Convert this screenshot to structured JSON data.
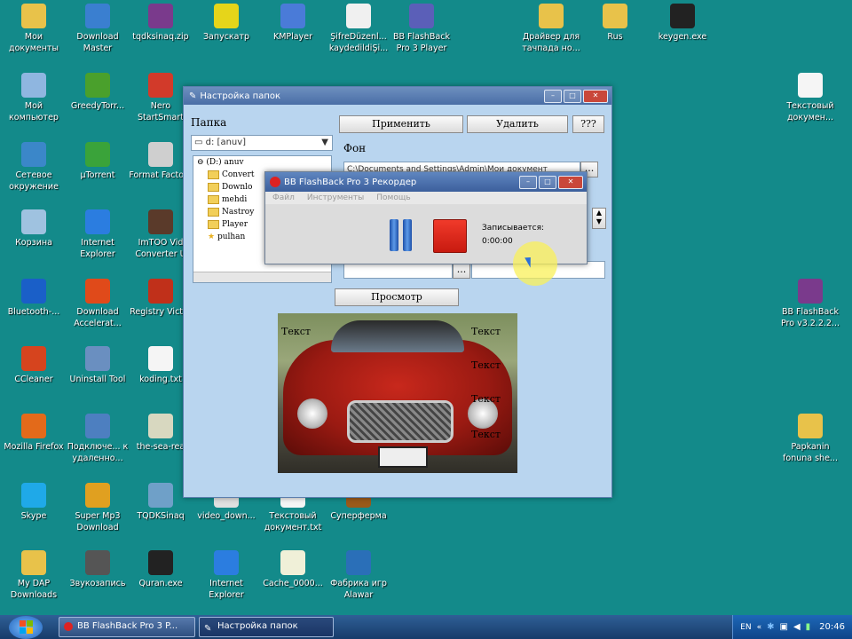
{
  "desktop_icons": [
    {
      "label": "Мои документы",
      "icon": "folder-icon",
      "color": "#e8c24a"
    },
    {
      "label": "Download Master",
      "icon": "download-master-icon",
      "color": "#3a7fd0"
    },
    {
      "label": "tqdksinaq.zip",
      "icon": "winrar-icon",
      "color": "#7a3a8c"
    },
    {
      "label": "Запускатр",
      "icon": "puzzle-icon",
      "color": "#e6d51a"
    },
    {
      "label": "KMPlayer",
      "icon": "kmplayer-icon",
      "color": "#4a7bd8"
    },
    {
      "label": "ŞifreDüzenl... kaydedildiŞi...",
      "icon": "document-icon",
      "color": "#f0f0f0"
    },
    {
      "label": "BB FlashBack Pro 3 Player",
      "icon": "bb-player-icon",
      "color": "#5b5fb8"
    },
    {
      "label": "Драйвер для тачпада но...",
      "icon": "folder-icon",
      "color": "#e8c24a"
    },
    {
      "label": "Rus",
      "icon": "folder-icon",
      "color": "#e8c24a"
    },
    {
      "label": "keygen.exe",
      "icon": "keygen-icon",
      "color": "#222222"
    },
    {
      "label": "Мой компьютер",
      "icon": "computer-icon",
      "color": "#8fb6e0"
    },
    {
      "label": "GreedyTorr...",
      "icon": "greedytorrent-icon",
      "color": "#4aa02c"
    },
    {
      "label": "Nero StartSmart",
      "icon": "nero-icon",
      "color": "#d23a2a"
    },
    {
      "label": "Текстовый докумен...",
      "icon": "text-document-icon",
      "color": "#f5f5f5"
    },
    {
      "label": "Сетевое окружение",
      "icon": "network-icon",
      "color": "#3b87c9"
    },
    {
      "label": "µTorrent",
      "icon": "utorrent-icon",
      "color": "#3aa33a"
    },
    {
      "label": "Format Factory",
      "icon": "format-factory-icon",
      "color": "#cfcfcf"
    },
    {
      "label": "Корзина",
      "icon": "recycle-bin-icon",
      "color": "#9fc2e0"
    },
    {
      "label": "Internet Explorer",
      "icon": "internet-explorer-icon",
      "color": "#2b7de0"
    },
    {
      "label": "ImTOO Vid Converter U",
      "icon": "imtoo-icon",
      "color": "#5a3a2a"
    },
    {
      "label": "Bluetooth-...",
      "icon": "bluetooth-icon",
      "color": "#1a5fc8"
    },
    {
      "label": "Download Accelerat...",
      "icon": "download-accelerator-icon",
      "color": "#e04a1a"
    },
    {
      "label": "Registry Victor",
      "icon": "registry-victor-icon",
      "color": "#c0301a"
    },
    {
      "label": "BB FlashBack Pro v3.2.2.2...",
      "icon": "winrar-icon",
      "color": "#7a3a8c"
    },
    {
      "label": "CCleaner",
      "icon": "ccleaner-icon",
      "color": "#d6441e"
    },
    {
      "label": "Uninstall Tool",
      "icon": "uninstall-tool-icon",
      "color": "#6a8fc0"
    },
    {
      "label": "koding.txt",
      "icon": "text-document-icon",
      "color": "#f5f5f5"
    },
    {
      "label": "Mozilla Firefox",
      "icon": "firefox-icon",
      "color": "#e36a1a"
    },
    {
      "label": "Подключе... к удаленно...",
      "icon": "remote-desktop-icon",
      "color": "#4d7fc0"
    },
    {
      "label": "the-sea-rea",
      "icon": "image-file-icon",
      "color": "#d8d8c0"
    },
    {
      "label": "Papkanin fonuna she...",
      "icon": "folder-icon",
      "color": "#e8c24a"
    },
    {
      "label": "Skype",
      "icon": "skype-icon",
      "color": "#1fa9e8"
    },
    {
      "label": "Super Mp3 Download",
      "icon": "super-mp3-icon",
      "color": "#e0a020"
    },
    {
      "label": "TQDKSinaq",
      "icon": "tqdk-icon",
      "color": "#6fa0c8"
    },
    {
      "label": "video_down...",
      "icon": "video-file-icon",
      "color": "#e0e0e0"
    },
    {
      "label": "Текстовый документ.txt",
      "icon": "text-document-icon",
      "color": "#f5f5f5"
    },
    {
      "label": "Суперферма",
      "icon": "superferma-icon",
      "color": "#9a5a1a"
    },
    {
      "label": "My DAP Downloads",
      "icon": "dap-folder-icon",
      "color": "#e8c24a"
    },
    {
      "label": "Звукозапись",
      "icon": "sound-recorder-icon",
      "color": "#555555"
    },
    {
      "label": "Quran.exe",
      "icon": "quran-icon",
      "color": "#222222"
    },
    {
      "label": "Internet Explorer",
      "icon": "internet-explorer-icon",
      "color": "#2b7de0"
    },
    {
      "label": "Cache_0000...",
      "icon": "cache-file-icon",
      "color": "#f0f0d8"
    },
    {
      "label": "Фабрика игр Alawar",
      "icon": "alawar-icon",
      "color": "#2a6fb8"
    }
  ],
  "folder_window": {
    "title": "Настройка папок",
    "folder_label": "Папка",
    "drive_select": "d: [anuv]",
    "buttons": {
      "apply": "Применить",
      "delete": "Удалить",
      "help": "???",
      "preview": "Просмотр",
      "browse": "..."
    },
    "background_label": "Фон",
    "background_path": "C:\\Documents and Settings\\Admin\\Мои документ",
    "tree": [
      {
        "label": "(D:) anuv",
        "type": "drive"
      },
      {
        "label": "Convert",
        "type": "folder"
      },
      {
        "label": "Downlo",
        "type": "folder"
      },
      {
        "label": "mehdi",
        "type": "folder"
      },
      {
        "label": "Nastroy",
        "type": "folder"
      },
      {
        "label": "Player",
        "type": "folder"
      },
      {
        "label": "pulhan",
        "type": "star"
      }
    ],
    "preview_texts": [
      "Текст",
      "Текст",
      "Текст",
      "Текст",
      "Текст"
    ]
  },
  "recorder": {
    "title": "BB FlashBack Pro 3 Рекордер",
    "menu": [
      "Файл",
      "Инструменты",
      "Помощь"
    ],
    "status_label": "Записывается:",
    "timer": "0:00:00"
  },
  "taskbar": {
    "tasks": [
      "BB FlashBack Pro 3 P...",
      "Настройка папок"
    ],
    "lang": "EN",
    "clock": "20:46"
  }
}
